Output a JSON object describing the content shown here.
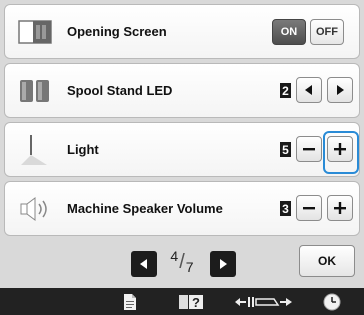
{
  "rows": [
    {
      "label": "Opening Screen",
      "on_label": "ON",
      "off_label": "OFF",
      "selected": "ON"
    },
    {
      "label": "Spool Stand LED",
      "value": "2"
    },
    {
      "label": "Light",
      "value": "5"
    },
    {
      "label": "Machine Speaker Volume",
      "value": "3"
    }
  ],
  "pager": {
    "current": "4",
    "total": "7"
  },
  "ok_label": "OK",
  "accent_color": "#2a8bd6",
  "icons": {
    "row0": "opening-screen-icon",
    "row1": "spool-stand-icon",
    "row2": "needle-light-icon",
    "row3": "speaker-icon",
    "bottom": [
      "page-icon",
      "help-icon",
      "presser-foot-icon",
      "clock-icon"
    ]
  }
}
